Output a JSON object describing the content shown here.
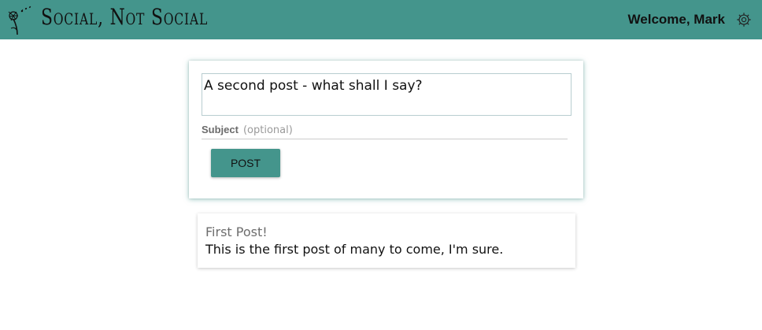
{
  "header": {
    "app_title": "Social, Not Social",
    "welcome_text": "Welcome, Mark",
    "logo_icon": "dandelion-icon",
    "settings_icon": "gear-icon"
  },
  "compose": {
    "post_text": "A second post - what shall I say?",
    "subject_label": "Subject",
    "subject_placeholder": "(optional)",
    "subject_value": "",
    "post_button_label": "POST"
  },
  "feed": {
    "posts": [
      {
        "subject": "First Post!",
        "body": "This is the first post of many to come, I'm sure."
      }
    ]
  },
  "colors": {
    "brand": "#44958c",
    "background": "#ffffff",
    "text": "#111111",
    "muted": "#6d6d6d"
  }
}
